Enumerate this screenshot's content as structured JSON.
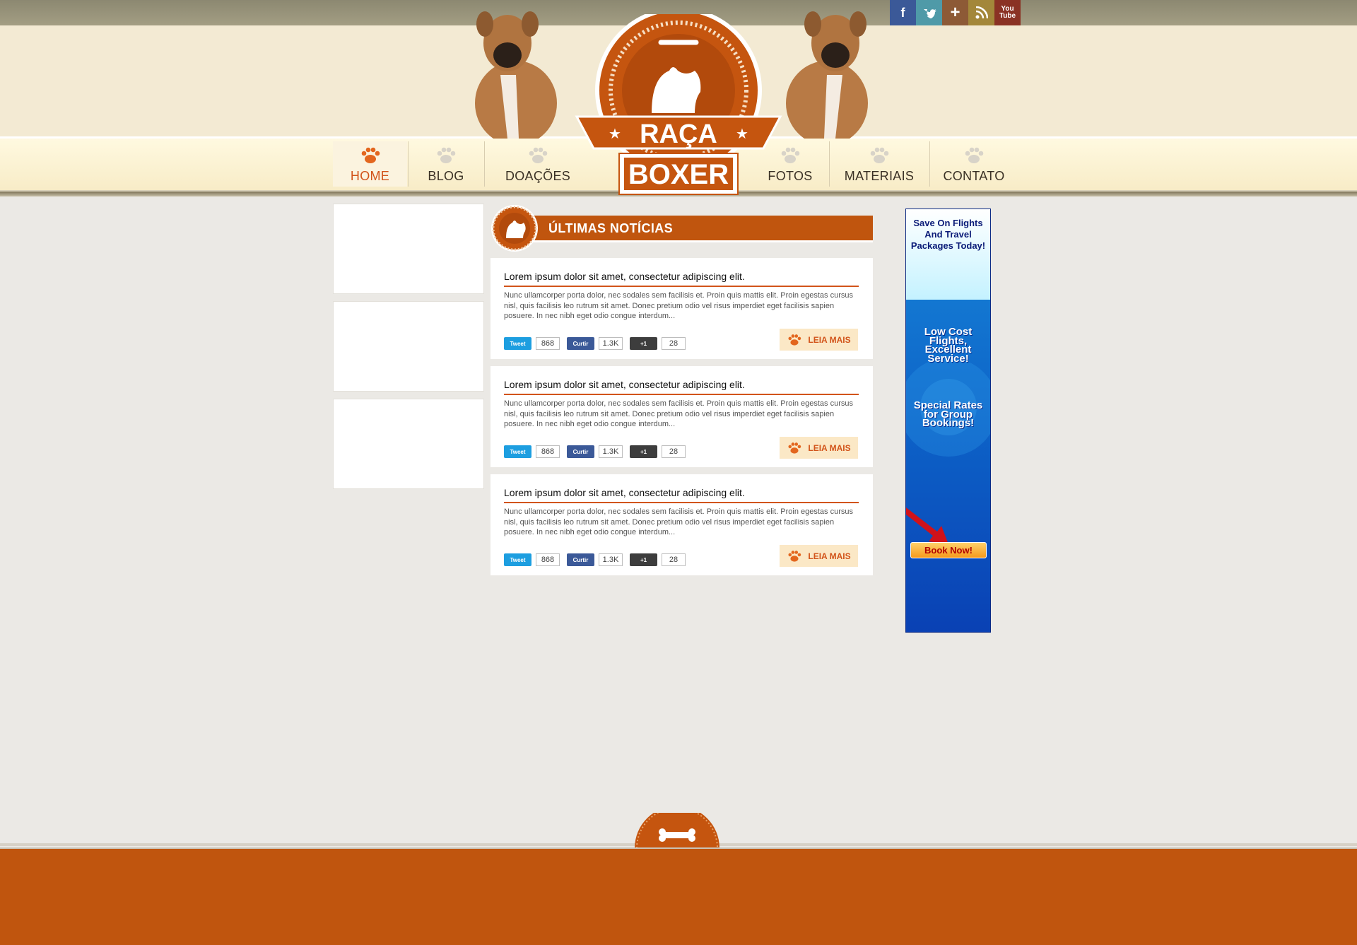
{
  "brand": {
    "logo_word1": "RAÇA",
    "logo_word2": "BOXER"
  },
  "social": [
    {
      "name": "facebook",
      "glyph": "f",
      "color": "#3b5998"
    },
    {
      "name": "twitter",
      "glyph": "t",
      "color": "#4f9aa8"
    },
    {
      "name": "plus",
      "glyph": "+",
      "color": "#8d5a36"
    },
    {
      "name": "rss",
      "glyph": "≡",
      "color": "#a3873a"
    },
    {
      "name": "youtube",
      "glyph": "You Tube",
      "color": "#8a3224"
    }
  ],
  "nav": {
    "home": "HOME",
    "blog": "BLOG",
    "doacoes": "DOAÇÕES",
    "fotos": "FOTOS",
    "materiais": "MATERIAIS",
    "contato": "CONTATO"
  },
  "section": {
    "title": "ÚLTIMAS NOTÍCIAS"
  },
  "posts": [
    {
      "title": "Lorem ipsum dolor sit amet, consectetur adipiscing elit.",
      "body": "Nunc ullamcorper porta dolor, nec sodales sem facilisis et. Proin quis mattis elit. Proin egestas cursus nisl, quis facilisis leo rutrum sit amet. Donec pretium odio vel risus imperdiet eget facilisis sapien posuere. In nec nibh eget odio congue interdum...",
      "tweet_label": "Tweet",
      "tweet_count": "868",
      "like_label": "Curtir",
      "like_count": "1.3K",
      "plus_label": "+1",
      "plus_count": "28",
      "read_more": "LEIA MAIS"
    },
    {
      "title": "Lorem ipsum dolor sit amet, consectetur adipiscing elit.",
      "body": "Nunc ullamcorper porta dolor, nec sodales sem facilisis et. Proin quis mattis elit. Proin egestas cursus nisl, quis facilisis leo rutrum sit amet. Donec pretium odio vel risus imperdiet eget facilisis sapien posuere. In nec nibh eget odio congue interdum...",
      "tweet_label": "Tweet",
      "tweet_count": "868",
      "like_label": "Curtir",
      "like_count": "1.3K",
      "plus_label": "+1",
      "plus_count": "28",
      "read_more": "LEIA MAIS"
    },
    {
      "title": "Lorem ipsum dolor sit amet, consectetur adipiscing elit.",
      "body": "Nunc ullamcorper porta dolor, nec sodales sem facilisis et. Proin quis mattis elit. Proin egestas cursus nisl, quis facilisis leo rutrum sit amet. Donec pretium odio vel risus imperdiet eget facilisis sapien posuere. In nec nibh eget odio congue interdum...",
      "tweet_label": "Tweet",
      "tweet_count": "868",
      "like_label": "Curtir",
      "like_count": "1.3K",
      "plus_label": "+1",
      "plus_count": "28",
      "read_more": "LEIA MAIS"
    }
  ],
  "ad": {
    "headline": "Save On Flights And Travel Packages Today!",
    "line1": "Low Cost Flights, Excellent Service!",
    "line2": "Special Rates for Group Bookings!",
    "cta": "Book Now!"
  },
  "colors": {
    "accent": "#c0550e",
    "nav_active": "#d2541a",
    "tweet": "#1d9ee0",
    "like": "#3b5998",
    "plus": "#3d3d3d"
  }
}
